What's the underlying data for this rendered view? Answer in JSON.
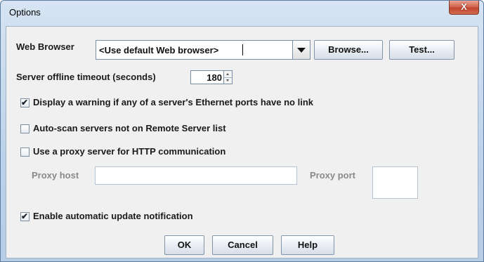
{
  "window": {
    "title": "Options",
    "close_symbol": "X"
  },
  "web_browser": {
    "label": "Web Browser",
    "value": "<Use default Web browser>",
    "browse_label": "Browse...",
    "test_label": "Test..."
  },
  "timeout": {
    "label": "Server offline timeout (seconds)",
    "value": "180"
  },
  "options": {
    "warn_ethernet": {
      "label": "Display a warning if any of a server's Ethernet ports have no link",
      "checked": true,
      "mark": "✔"
    },
    "auto_scan": {
      "label": "Auto-scan servers not on Remote Server list",
      "checked": false
    },
    "use_proxy": {
      "label": "Use a proxy server for HTTP communication",
      "checked": false
    },
    "auto_update": {
      "label": "Enable automatic update notification",
      "checked": true,
      "mark": "✔"
    }
  },
  "proxy": {
    "host_label": "Proxy host",
    "host_value": "",
    "port_label": "Proxy port",
    "port_value": ""
  },
  "buttons": {
    "ok": "OK",
    "cancel": "Cancel",
    "help": "Help"
  },
  "colors": {
    "title_bar": "#c6d9ee",
    "close_button": "#c9533a",
    "panel": "#f0f0f0"
  }
}
